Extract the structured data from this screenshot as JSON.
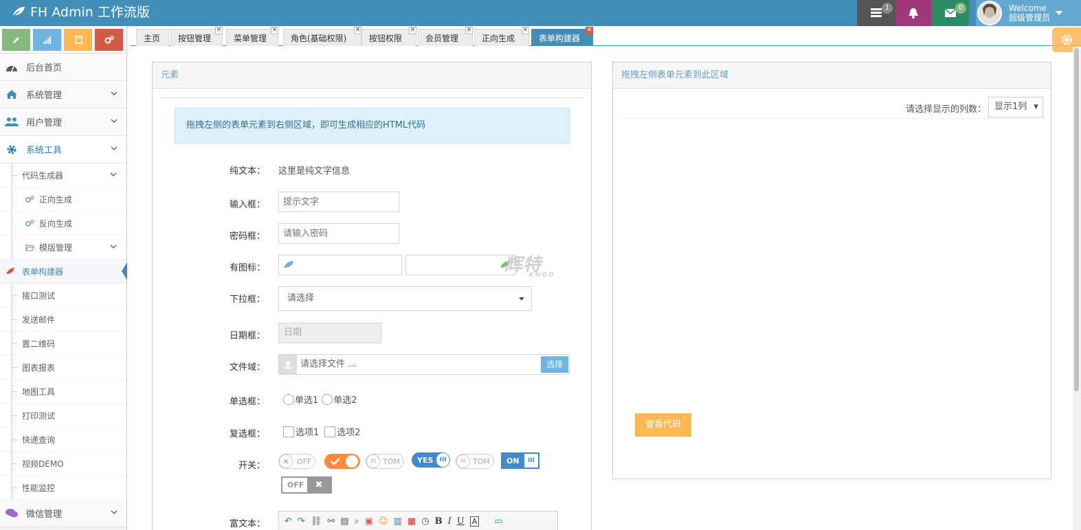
{
  "app": {
    "title": "FH Admin 工作流版"
  },
  "navbar": {
    "tasks_count": "1",
    "notifications_count": "",
    "messages_count": "0",
    "user_welcome": "Welcome",
    "user_name": "超级管理员"
  },
  "sidebar": {
    "items": [
      {
        "label": "后台首页"
      },
      {
        "label": "系统管理"
      },
      {
        "label": "用户管理"
      },
      {
        "label": "系统工具"
      }
    ],
    "tools_sub": [
      {
        "label": "代码生成器"
      },
      {
        "label": "正向生成"
      },
      {
        "label": "反向生成"
      },
      {
        "label": "模版管理"
      },
      {
        "label": "表单构建器"
      },
      {
        "label": "接口测试"
      },
      {
        "label": "发送邮件"
      },
      {
        "label": "置二维码"
      },
      {
        "label": "图表报表"
      },
      {
        "label": "地图工具"
      },
      {
        "label": "打印测试"
      },
      {
        "label": "快递查询"
      },
      {
        "label": "视频DEMO"
      },
      {
        "label": "性能监控"
      }
    ],
    "wechat": {
      "label": "微信管理"
    }
  },
  "tabs": [
    {
      "label": "主页"
    },
    {
      "label": "按钮管理"
    },
    {
      "label": "菜单管理"
    },
    {
      "label": "角色(基础权限)"
    },
    {
      "label": "按钮权限"
    },
    {
      "label": "会员管理"
    },
    {
      "label": "正向生成"
    },
    {
      "label": "表单构建器"
    }
  ],
  "left_panel": {
    "title": "元素",
    "alert": "拖拽左侧的表单元素到右侧区域，即可生成相应的HTML代码",
    "plain_text": {
      "label": "纯文本：",
      "value": "这里是纯文字信息"
    },
    "input": {
      "label": "输入框：",
      "placeholder": "提示文字"
    },
    "password": {
      "label": "密码框：",
      "placeholder": "请输入密码"
    },
    "icon_input": {
      "label": "有图标："
    },
    "select": {
      "label": "下拉框：",
      "value": "请选择"
    },
    "date": {
      "label": "日期框：",
      "placeholder": "日期"
    },
    "file": {
      "label": "文件域：",
      "placeholder": "请选择文件 ...",
      "button": "选择"
    },
    "radio": {
      "label": "单选框：",
      "options": [
        "单选1",
        "单选2"
      ]
    },
    "checkbox": {
      "label": "复选框：",
      "options": [
        "选项1",
        "选项2"
      ]
    },
    "switch": {
      "label": "开关：",
      "labels": [
        "OFF",
        "TOM",
        "YES",
        "TOM",
        "ON",
        "OFF"
      ]
    },
    "richtext": {
      "label": "富文本："
    }
  },
  "right_panel": {
    "title": "拖拽左侧表单元素到此区域",
    "columns_label": "请选择显示的列数：",
    "columns_value": "显示1列",
    "view_code": "查看代码"
  },
  "watermark": {
    "text": "辉特",
    "sub": "KHOD"
  },
  "colors": {
    "navbar": "#438eb9",
    "accent_orange": "#ffb752",
    "tab_active": "#438eb9"
  }
}
